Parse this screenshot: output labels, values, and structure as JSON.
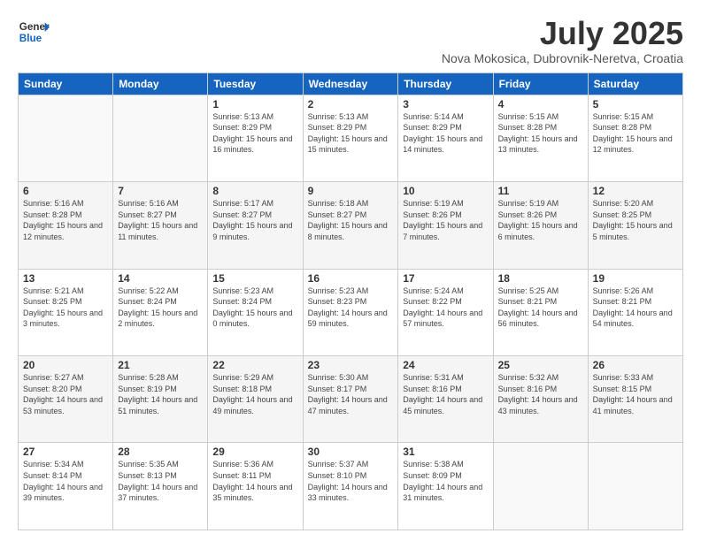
{
  "logo": {
    "line1": "General",
    "line2": "Blue"
  },
  "title": "July 2025",
  "subtitle": "Nova Mokosica, Dubrovnik-Neretva, Croatia",
  "weekdays": [
    "Sunday",
    "Monday",
    "Tuesday",
    "Wednesday",
    "Thursday",
    "Friday",
    "Saturday"
  ],
  "weeks": [
    [
      {
        "day": "",
        "info": ""
      },
      {
        "day": "",
        "info": ""
      },
      {
        "day": "1",
        "info": "Sunrise: 5:13 AM\nSunset: 8:29 PM\nDaylight: 15 hours and 16 minutes."
      },
      {
        "day": "2",
        "info": "Sunrise: 5:13 AM\nSunset: 8:29 PM\nDaylight: 15 hours and 15 minutes."
      },
      {
        "day": "3",
        "info": "Sunrise: 5:14 AM\nSunset: 8:29 PM\nDaylight: 15 hours and 14 minutes."
      },
      {
        "day": "4",
        "info": "Sunrise: 5:15 AM\nSunset: 8:28 PM\nDaylight: 15 hours and 13 minutes."
      },
      {
        "day": "5",
        "info": "Sunrise: 5:15 AM\nSunset: 8:28 PM\nDaylight: 15 hours and 12 minutes."
      }
    ],
    [
      {
        "day": "6",
        "info": "Sunrise: 5:16 AM\nSunset: 8:28 PM\nDaylight: 15 hours and 12 minutes."
      },
      {
        "day": "7",
        "info": "Sunrise: 5:16 AM\nSunset: 8:27 PM\nDaylight: 15 hours and 11 minutes."
      },
      {
        "day": "8",
        "info": "Sunrise: 5:17 AM\nSunset: 8:27 PM\nDaylight: 15 hours and 9 minutes."
      },
      {
        "day": "9",
        "info": "Sunrise: 5:18 AM\nSunset: 8:27 PM\nDaylight: 15 hours and 8 minutes."
      },
      {
        "day": "10",
        "info": "Sunrise: 5:19 AM\nSunset: 8:26 PM\nDaylight: 15 hours and 7 minutes."
      },
      {
        "day": "11",
        "info": "Sunrise: 5:19 AM\nSunset: 8:26 PM\nDaylight: 15 hours and 6 minutes."
      },
      {
        "day": "12",
        "info": "Sunrise: 5:20 AM\nSunset: 8:25 PM\nDaylight: 15 hours and 5 minutes."
      }
    ],
    [
      {
        "day": "13",
        "info": "Sunrise: 5:21 AM\nSunset: 8:25 PM\nDaylight: 15 hours and 3 minutes."
      },
      {
        "day": "14",
        "info": "Sunrise: 5:22 AM\nSunset: 8:24 PM\nDaylight: 15 hours and 2 minutes."
      },
      {
        "day": "15",
        "info": "Sunrise: 5:23 AM\nSunset: 8:24 PM\nDaylight: 15 hours and 0 minutes."
      },
      {
        "day": "16",
        "info": "Sunrise: 5:23 AM\nSunset: 8:23 PM\nDaylight: 14 hours and 59 minutes."
      },
      {
        "day": "17",
        "info": "Sunrise: 5:24 AM\nSunset: 8:22 PM\nDaylight: 14 hours and 57 minutes."
      },
      {
        "day": "18",
        "info": "Sunrise: 5:25 AM\nSunset: 8:21 PM\nDaylight: 14 hours and 56 minutes."
      },
      {
        "day": "19",
        "info": "Sunrise: 5:26 AM\nSunset: 8:21 PM\nDaylight: 14 hours and 54 minutes."
      }
    ],
    [
      {
        "day": "20",
        "info": "Sunrise: 5:27 AM\nSunset: 8:20 PM\nDaylight: 14 hours and 53 minutes."
      },
      {
        "day": "21",
        "info": "Sunrise: 5:28 AM\nSunset: 8:19 PM\nDaylight: 14 hours and 51 minutes."
      },
      {
        "day": "22",
        "info": "Sunrise: 5:29 AM\nSunset: 8:18 PM\nDaylight: 14 hours and 49 minutes."
      },
      {
        "day": "23",
        "info": "Sunrise: 5:30 AM\nSunset: 8:17 PM\nDaylight: 14 hours and 47 minutes."
      },
      {
        "day": "24",
        "info": "Sunrise: 5:31 AM\nSunset: 8:16 PM\nDaylight: 14 hours and 45 minutes."
      },
      {
        "day": "25",
        "info": "Sunrise: 5:32 AM\nSunset: 8:16 PM\nDaylight: 14 hours and 43 minutes."
      },
      {
        "day": "26",
        "info": "Sunrise: 5:33 AM\nSunset: 8:15 PM\nDaylight: 14 hours and 41 minutes."
      }
    ],
    [
      {
        "day": "27",
        "info": "Sunrise: 5:34 AM\nSunset: 8:14 PM\nDaylight: 14 hours and 39 minutes."
      },
      {
        "day": "28",
        "info": "Sunrise: 5:35 AM\nSunset: 8:13 PM\nDaylight: 14 hours and 37 minutes."
      },
      {
        "day": "29",
        "info": "Sunrise: 5:36 AM\nSunset: 8:11 PM\nDaylight: 14 hours and 35 minutes."
      },
      {
        "day": "30",
        "info": "Sunrise: 5:37 AM\nSunset: 8:10 PM\nDaylight: 14 hours and 33 minutes."
      },
      {
        "day": "31",
        "info": "Sunrise: 5:38 AM\nSunset: 8:09 PM\nDaylight: 14 hours and 31 minutes."
      },
      {
        "day": "",
        "info": ""
      },
      {
        "day": "",
        "info": ""
      }
    ]
  ]
}
